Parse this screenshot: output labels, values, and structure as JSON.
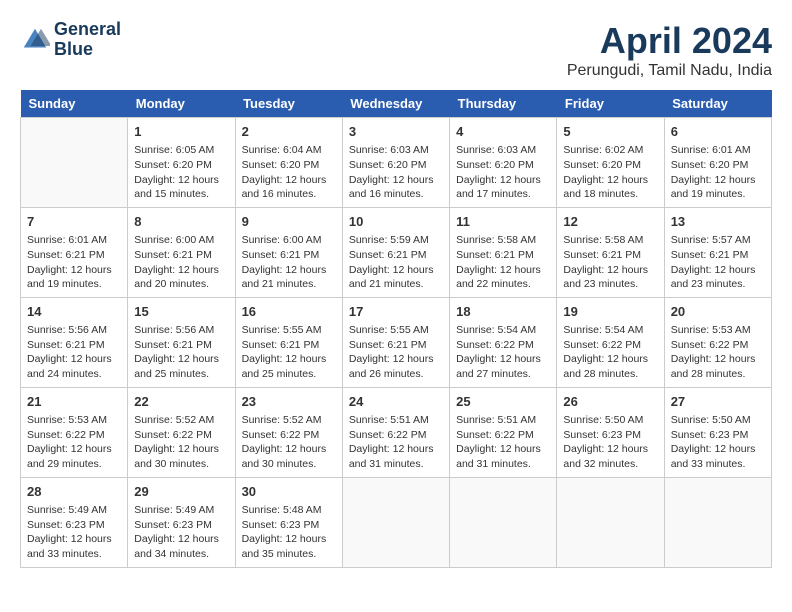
{
  "header": {
    "logo_line1": "General",
    "logo_line2": "Blue",
    "month": "April 2024",
    "location": "Perungudi, Tamil Nadu, India"
  },
  "weekdays": [
    "Sunday",
    "Monday",
    "Tuesday",
    "Wednesday",
    "Thursday",
    "Friday",
    "Saturday"
  ],
  "weeks": [
    [
      {
        "day": "",
        "info": ""
      },
      {
        "day": "1",
        "info": "Sunrise: 6:05 AM\nSunset: 6:20 PM\nDaylight: 12 hours\nand 15 minutes."
      },
      {
        "day": "2",
        "info": "Sunrise: 6:04 AM\nSunset: 6:20 PM\nDaylight: 12 hours\nand 16 minutes."
      },
      {
        "day": "3",
        "info": "Sunrise: 6:03 AM\nSunset: 6:20 PM\nDaylight: 12 hours\nand 16 minutes."
      },
      {
        "day": "4",
        "info": "Sunrise: 6:03 AM\nSunset: 6:20 PM\nDaylight: 12 hours\nand 17 minutes."
      },
      {
        "day": "5",
        "info": "Sunrise: 6:02 AM\nSunset: 6:20 PM\nDaylight: 12 hours\nand 18 minutes."
      },
      {
        "day": "6",
        "info": "Sunrise: 6:01 AM\nSunset: 6:20 PM\nDaylight: 12 hours\nand 19 minutes."
      }
    ],
    [
      {
        "day": "7",
        "info": "Sunrise: 6:01 AM\nSunset: 6:21 PM\nDaylight: 12 hours\nand 19 minutes."
      },
      {
        "day": "8",
        "info": "Sunrise: 6:00 AM\nSunset: 6:21 PM\nDaylight: 12 hours\nand 20 minutes."
      },
      {
        "day": "9",
        "info": "Sunrise: 6:00 AM\nSunset: 6:21 PM\nDaylight: 12 hours\nand 21 minutes."
      },
      {
        "day": "10",
        "info": "Sunrise: 5:59 AM\nSunset: 6:21 PM\nDaylight: 12 hours\nand 21 minutes."
      },
      {
        "day": "11",
        "info": "Sunrise: 5:58 AM\nSunset: 6:21 PM\nDaylight: 12 hours\nand 22 minutes."
      },
      {
        "day": "12",
        "info": "Sunrise: 5:58 AM\nSunset: 6:21 PM\nDaylight: 12 hours\nand 23 minutes."
      },
      {
        "day": "13",
        "info": "Sunrise: 5:57 AM\nSunset: 6:21 PM\nDaylight: 12 hours\nand 23 minutes."
      }
    ],
    [
      {
        "day": "14",
        "info": "Sunrise: 5:56 AM\nSunset: 6:21 PM\nDaylight: 12 hours\nand 24 minutes."
      },
      {
        "day": "15",
        "info": "Sunrise: 5:56 AM\nSunset: 6:21 PM\nDaylight: 12 hours\nand 25 minutes."
      },
      {
        "day": "16",
        "info": "Sunrise: 5:55 AM\nSunset: 6:21 PM\nDaylight: 12 hours\nand 25 minutes."
      },
      {
        "day": "17",
        "info": "Sunrise: 5:55 AM\nSunset: 6:21 PM\nDaylight: 12 hours\nand 26 minutes."
      },
      {
        "day": "18",
        "info": "Sunrise: 5:54 AM\nSunset: 6:22 PM\nDaylight: 12 hours\nand 27 minutes."
      },
      {
        "day": "19",
        "info": "Sunrise: 5:54 AM\nSunset: 6:22 PM\nDaylight: 12 hours\nand 28 minutes."
      },
      {
        "day": "20",
        "info": "Sunrise: 5:53 AM\nSunset: 6:22 PM\nDaylight: 12 hours\nand 28 minutes."
      }
    ],
    [
      {
        "day": "21",
        "info": "Sunrise: 5:53 AM\nSunset: 6:22 PM\nDaylight: 12 hours\nand 29 minutes."
      },
      {
        "day": "22",
        "info": "Sunrise: 5:52 AM\nSunset: 6:22 PM\nDaylight: 12 hours\nand 30 minutes."
      },
      {
        "day": "23",
        "info": "Sunrise: 5:52 AM\nSunset: 6:22 PM\nDaylight: 12 hours\nand 30 minutes."
      },
      {
        "day": "24",
        "info": "Sunrise: 5:51 AM\nSunset: 6:22 PM\nDaylight: 12 hours\nand 31 minutes."
      },
      {
        "day": "25",
        "info": "Sunrise: 5:51 AM\nSunset: 6:22 PM\nDaylight: 12 hours\nand 31 minutes."
      },
      {
        "day": "26",
        "info": "Sunrise: 5:50 AM\nSunset: 6:23 PM\nDaylight: 12 hours\nand 32 minutes."
      },
      {
        "day": "27",
        "info": "Sunrise: 5:50 AM\nSunset: 6:23 PM\nDaylight: 12 hours\nand 33 minutes."
      }
    ],
    [
      {
        "day": "28",
        "info": "Sunrise: 5:49 AM\nSunset: 6:23 PM\nDaylight: 12 hours\nand 33 minutes."
      },
      {
        "day": "29",
        "info": "Sunrise: 5:49 AM\nSunset: 6:23 PM\nDaylight: 12 hours\nand 34 minutes."
      },
      {
        "day": "30",
        "info": "Sunrise: 5:48 AM\nSunset: 6:23 PM\nDaylight: 12 hours\nand 35 minutes."
      },
      {
        "day": "",
        "info": ""
      },
      {
        "day": "",
        "info": ""
      },
      {
        "day": "",
        "info": ""
      },
      {
        "day": "",
        "info": ""
      }
    ]
  ]
}
